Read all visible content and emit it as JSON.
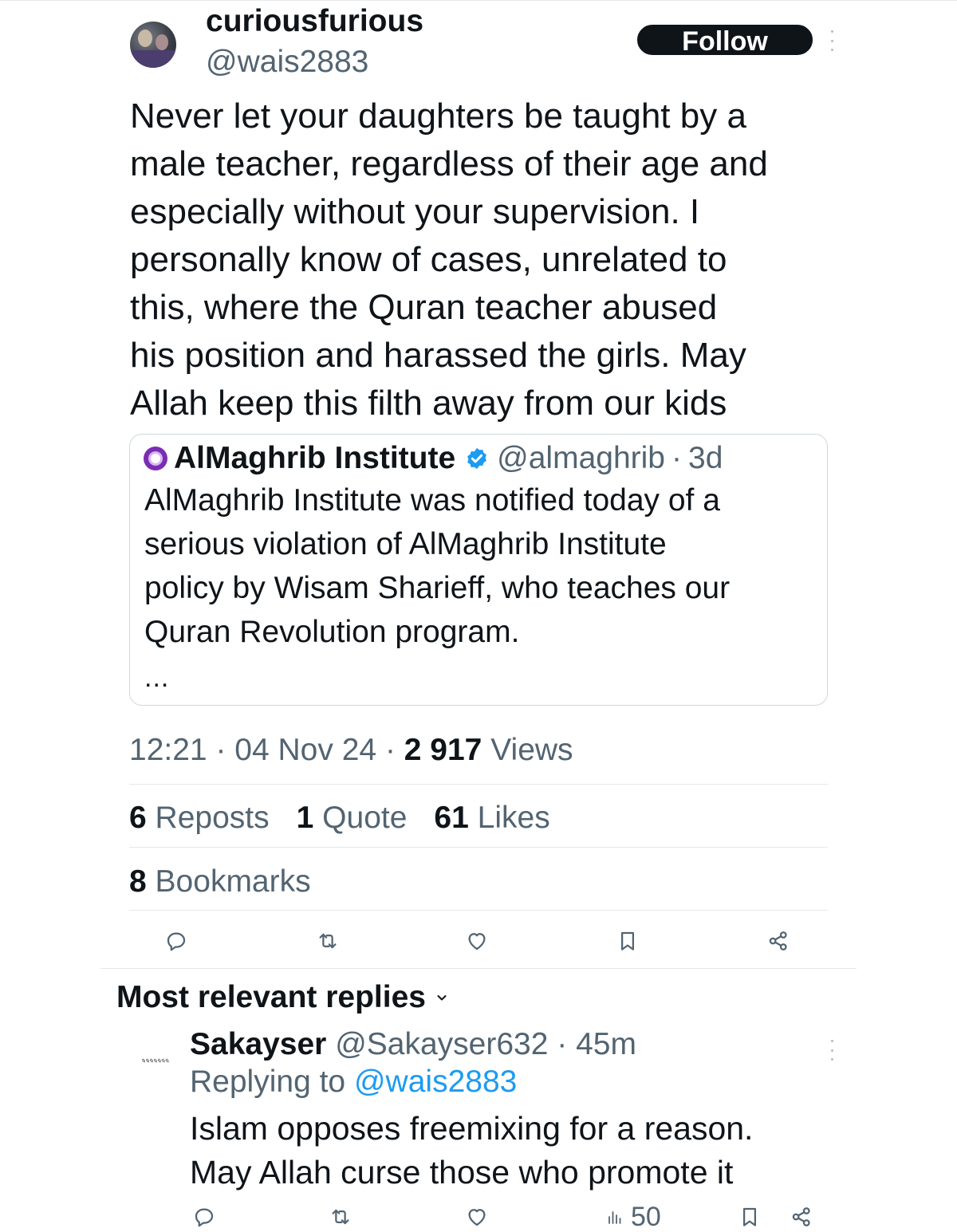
{
  "tweet": {
    "author": {
      "display_name": "curiousfurious",
      "handle": "@wais2883"
    },
    "follow_label": "Follow",
    "text_lines": [
      "Never let your daughters be taught by a",
      "male teacher, regardless of their age and",
      "especially without your supervision. I",
      "personally know of cases, unrelated to",
      "this, where the Quran teacher abused",
      "his position and harassed the girls. May",
      "Allah keep this filth away from our kids"
    ],
    "quote": {
      "name": "AlMaghrib Institute",
      "handle": "@almaghrib",
      "separator": "·",
      "age": "3d",
      "text_lines": [
        "AlMaghrib Institute was notified today of a",
        "serious violation of AlMaghrib Institute",
        "policy by Wisam Sharieff, who teaches our",
        "Quran Revolution program."
      ],
      "ellipsis": "..."
    },
    "meta": {
      "time": "12:21",
      "sep1": "·",
      "date": "04 Nov 24",
      "sep2": "·",
      "views_count": "2 917",
      "views_label": "Views"
    },
    "stats": {
      "reposts_count": "6",
      "reposts_label": "Reposts",
      "quotes_count": "1",
      "quotes_label": "Quote",
      "likes_count": "61",
      "likes_label": "Likes",
      "bookmarks_count": "8",
      "bookmarks_label": "Bookmarks"
    },
    "actions": [
      "reply-icon",
      "repost-icon",
      "like-icon",
      "bookmark-icon",
      "share-icon"
    ]
  },
  "replies": {
    "heading": "Most relevant replies",
    "items": [
      {
        "display_name": "Sakayser",
        "handle": "@Sakayser632",
        "separator": "·",
        "age": "45m",
        "replying_prefix": "Replying to",
        "replying_handle": "@wais2883",
        "text_lines": [
          "Islam opposes freemixing for a reason.",
          "May Allah curse those who promote it"
        ],
        "views": "50"
      }
    ]
  },
  "colors": {
    "text": "#0f1419",
    "secondary": "#536471",
    "link": "#1d9bf0",
    "border": "#cfd9de",
    "follow_bg": "#0f1419",
    "brand_purple": "#7b2cb4"
  }
}
